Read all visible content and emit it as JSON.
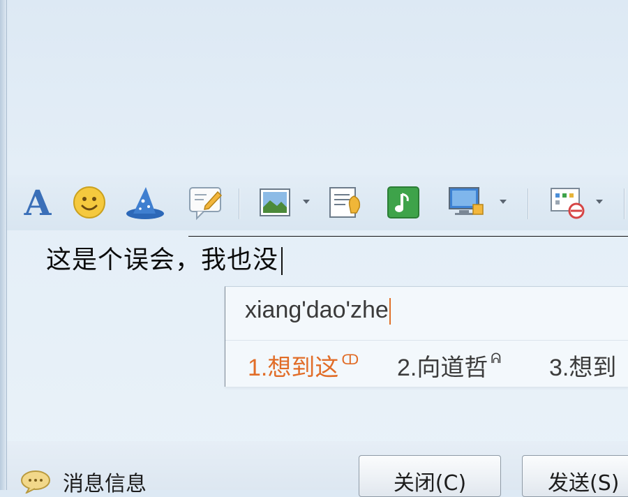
{
  "toolbar": {
    "items": [
      {
        "name": "font",
        "icon": "font-A-icon",
        "label": "A"
      },
      {
        "name": "emoji",
        "icon": "smiley-icon"
      },
      {
        "name": "magic",
        "icon": "wizard-hat-icon"
      },
      {
        "name": "doodle",
        "icon": "edit-bubble-icon"
      },
      {
        "name": "image",
        "icon": "picture-icon",
        "has_dropdown": true
      },
      {
        "name": "clipboard",
        "icon": "clipboard-icon"
      },
      {
        "name": "music",
        "icon": "music-note-icon"
      },
      {
        "name": "screenshot",
        "icon": "screen-capture-icon",
        "has_dropdown": true
      },
      {
        "name": "apps",
        "icon": "apps-grid-icon",
        "has_dropdown": true
      }
    ]
  },
  "editor": {
    "text": "这是个误会，我也没"
  },
  "ime": {
    "input": "xiang'dao'zhe",
    "candidates": [
      {
        "label": "1.想到这",
        "badge": "ↀ",
        "selected": true
      },
      {
        "label": "2.向道哲",
        "badge": "ᕱ",
        "selected": false
      },
      {
        "label": "3.想到",
        "badge": "",
        "selected": false
      }
    ],
    "accent_color": "#e16d28"
  },
  "footer": {
    "message_info_label": "消息信息",
    "close_button": "关闭(C)",
    "send_button": "发送(S)"
  }
}
